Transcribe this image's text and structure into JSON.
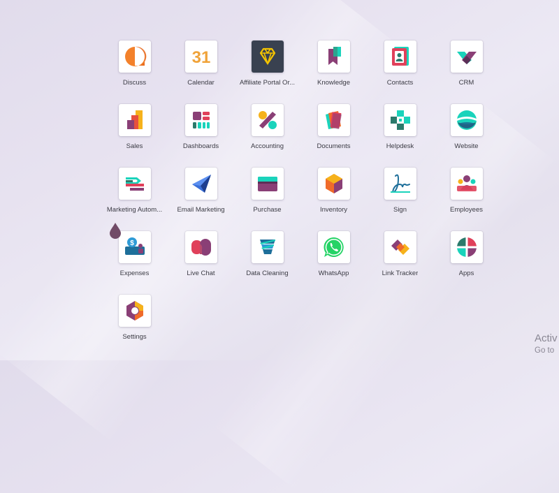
{
  "apps": [
    {
      "id": "discuss",
      "label": "Discuss",
      "icon": "discuss-icon"
    },
    {
      "id": "calendar",
      "label": "Calendar",
      "icon": "calendar-icon",
      "icon_text": "31"
    },
    {
      "id": "affiliate-portal",
      "label": "Affiliate Portal Or...",
      "icon": "diamond-icon"
    },
    {
      "id": "knowledge",
      "label": "Knowledge",
      "icon": "bookmark-icon"
    },
    {
      "id": "contacts",
      "label": "Contacts",
      "icon": "contact-card-icon"
    },
    {
      "id": "crm",
      "label": "CRM",
      "icon": "handshake-icon"
    },
    {
      "id": "sales",
      "label": "Sales",
      "icon": "bar-chart-icon"
    },
    {
      "id": "dashboards",
      "label": "Dashboards",
      "icon": "dashboard-icon"
    },
    {
      "id": "accounting",
      "label": "Accounting",
      "icon": "percent-icon"
    },
    {
      "id": "documents",
      "label": "Documents",
      "icon": "documents-icon"
    },
    {
      "id": "helpdesk",
      "label": "Helpdesk",
      "icon": "helpdesk-cross-icon"
    },
    {
      "id": "website",
      "label": "Website",
      "icon": "globe-icon"
    },
    {
      "id": "marketing-automation",
      "label": "Marketing Autom...",
      "icon": "automation-icon"
    },
    {
      "id": "email-marketing",
      "label": "Email Marketing",
      "icon": "paper-plane-icon"
    },
    {
      "id": "purchase",
      "label": "Purchase",
      "icon": "credit-card-icon"
    },
    {
      "id": "inventory",
      "label": "Inventory",
      "icon": "box-icon"
    },
    {
      "id": "sign",
      "label": "Sign",
      "icon": "signature-icon"
    },
    {
      "id": "employees",
      "label": "Employees",
      "icon": "people-icon"
    },
    {
      "id": "expenses",
      "label": "Expenses",
      "icon": "money-icon"
    },
    {
      "id": "live-chat",
      "label": "Live Chat",
      "icon": "chat-bubbles-icon"
    },
    {
      "id": "data-cleaning",
      "label": "Data Cleaning",
      "icon": "data-cleaning-icon"
    },
    {
      "id": "whatsapp",
      "label": "WhatsApp",
      "icon": "whatsapp-icon"
    },
    {
      "id": "link-tracker",
      "label": "Link Tracker",
      "icon": "link-icon"
    },
    {
      "id": "apps",
      "label": "Apps",
      "icon": "apps-circle-icon"
    },
    {
      "id": "settings",
      "label": "Settings",
      "icon": "settings-hex-icon"
    }
  ],
  "watermark": {
    "line1": "Activ",
    "line2": "Go to"
  },
  "colors": {
    "accent_purple": "#714b67",
    "teal": "#1ad3bb",
    "orange": "#f06b2a"
  }
}
